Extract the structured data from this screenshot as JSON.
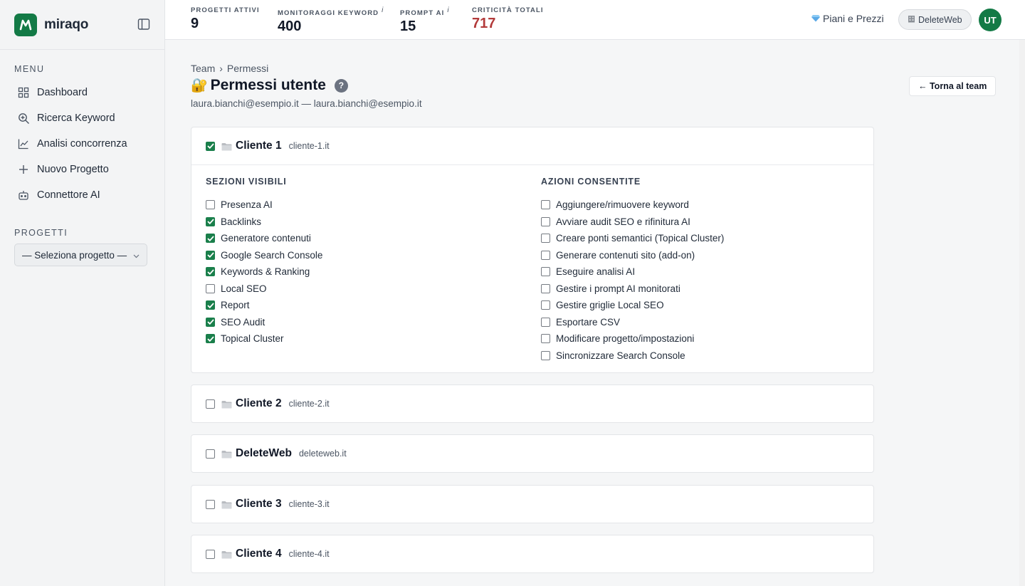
{
  "brand": {
    "name": "miraqo",
    "accent": "#137a46"
  },
  "sidebar": {
    "menu_heading": "MENU",
    "items": [
      {
        "label": "Dashboard",
        "icon": "grid-icon"
      },
      {
        "label": "Ricerca Keyword",
        "icon": "search-icon"
      },
      {
        "label": "Analisi concorrenza",
        "icon": "chart-line-icon"
      },
      {
        "label": "Nuovo Progetto",
        "icon": "plus-icon"
      },
      {
        "label": "Connettore AI",
        "icon": "robot-icon"
      }
    ],
    "projects_heading": "PROGETTI",
    "project_select": "— Seleziona progetto —"
  },
  "topbar": {
    "stats": [
      {
        "label": "PROGETTI ATTIVI",
        "value": "9",
        "info": ""
      },
      {
        "label": "MONITORAGGI KEYWORD",
        "value": "400",
        "info": "i"
      },
      {
        "label": "PROMPT AI",
        "value": "15",
        "info": "i"
      },
      {
        "label": "CRITICITÀ TOTALI",
        "value": "717",
        "info": "",
        "color": "#b23a3a"
      }
    ],
    "pricing": "Piani e Prezzi",
    "workspace": "DeleteWeb",
    "avatar": "UT"
  },
  "page": {
    "breadcrumb": [
      "Team",
      "›",
      "Permessi"
    ],
    "title_emoji": "🔐",
    "title": "Permessi utente",
    "help": "?",
    "user_line": "laura.bianchi@esempio.it — laura.bianchi@esempio.it",
    "back_button": "← Torna al team"
  },
  "projects": [
    {
      "name": "Cliente 1",
      "domain": "cliente-1.it",
      "checked": true,
      "expanded": true,
      "sections_title": "SEZIONI VISIBILI",
      "sections": [
        {
          "label": "Presenza AI",
          "checked": false
        },
        {
          "label": "Backlinks",
          "checked": true
        },
        {
          "label": "Generatore contenuti",
          "checked": true
        },
        {
          "label": "Google Search Console",
          "checked": true
        },
        {
          "label": "Keywords & Ranking",
          "checked": true
        },
        {
          "label": "Local SEO",
          "checked": false
        },
        {
          "label": "Report",
          "checked": true
        },
        {
          "label": "SEO Audit",
          "checked": true
        },
        {
          "label": "Topical Cluster",
          "checked": true
        }
      ],
      "actions_title": "AZIONI CONSENTITE",
      "actions": [
        {
          "label": "Aggiungere/rimuovere keyword",
          "checked": false
        },
        {
          "label": "Avviare audit SEO e rifinitura AI",
          "checked": false
        },
        {
          "label": "Creare ponti semantici (Topical Cluster)",
          "checked": false
        },
        {
          "label": "Generare contenuti sito (add-on)",
          "checked": false
        },
        {
          "label": "Eseguire analisi AI",
          "checked": false
        },
        {
          "label": "Gestire i prompt AI monitorati",
          "checked": false
        },
        {
          "label": "Gestire griglie Local SEO",
          "checked": false
        },
        {
          "label": "Esportare CSV",
          "checked": false
        },
        {
          "label": "Modificare progetto/impostazioni",
          "checked": false
        },
        {
          "label": "Sincronizzare Search Console",
          "checked": false
        }
      ]
    },
    {
      "name": "Cliente 2",
      "domain": "cliente-2.it",
      "checked": false,
      "expanded": false
    },
    {
      "name": "DeleteWeb",
      "domain": "deleteweb.it",
      "checked": false,
      "expanded": false
    },
    {
      "name": "Cliente 3",
      "domain": "cliente-3.it",
      "checked": false,
      "expanded": false
    },
    {
      "name": "Cliente 4",
      "domain": "cliente-4.it",
      "checked": false,
      "expanded": false
    }
  ]
}
